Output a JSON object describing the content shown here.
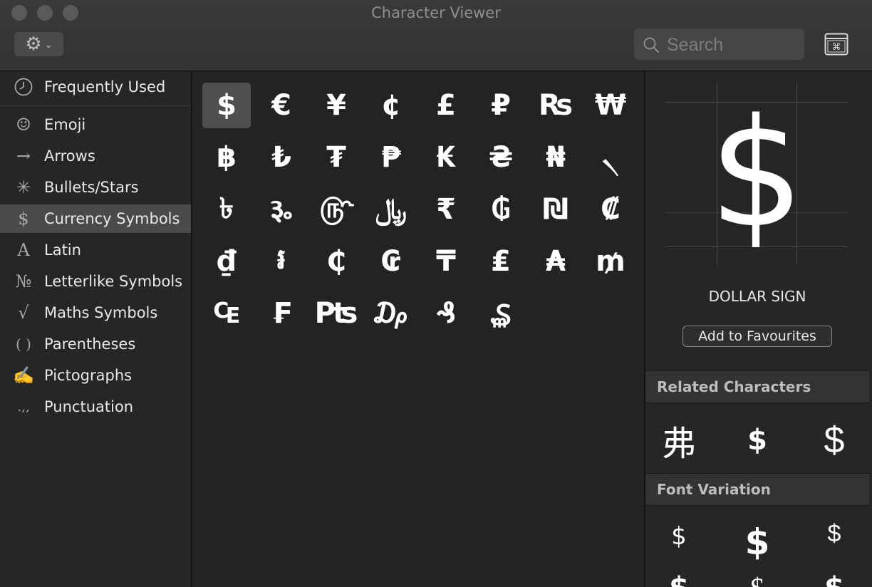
{
  "window": {
    "title": "Character Viewer"
  },
  "toolbar": {
    "search_placeholder": "Search"
  },
  "sidebar": {
    "items": [
      {
        "label": "Frequently Used",
        "icon": "clock-icon",
        "glyph": "◷"
      },
      {
        "label": "Emoji",
        "icon": "smiley-icon",
        "glyph": "☺"
      },
      {
        "label": "Arrows",
        "icon": "arrow-right-icon",
        "glyph": "→"
      },
      {
        "label": "Bullets/Stars",
        "icon": "asterisk-icon",
        "glyph": "✳"
      },
      {
        "label": "Currency Symbols",
        "icon": "dollar-icon",
        "glyph": "$"
      },
      {
        "label": "Latin",
        "icon": "letter-a-icon",
        "glyph": "A"
      },
      {
        "label": "Letterlike Symbols",
        "icon": "numero-icon",
        "glyph": "№"
      },
      {
        "label": "Maths Symbols",
        "icon": "square-root-icon",
        "glyph": "√"
      },
      {
        "label": "Parentheses",
        "icon": "parentheses-icon",
        "glyph": "( )"
      },
      {
        "label": "Pictographs",
        "icon": "writing-hand-icon",
        "glyph": "✍"
      },
      {
        "label": "Punctuation",
        "icon": "comma-icon",
        "glyph": "․,,"
      }
    ],
    "selected_index": 4
  },
  "characters": [
    "$",
    "€",
    "¥",
    "¢",
    "£",
    "₽",
    "₨",
    "₩",
    "฿",
    "₺",
    "₮",
    "₱",
    "₭",
    "₴",
    "₦",
    "৲",
    "৳",
    "૱",
    "௹",
    "﷼",
    "₹",
    "₲",
    "₪",
    "₡",
    "₫",
    "៛",
    "₵",
    "₢",
    "₸",
    "₤",
    "₳",
    "₥",
    "₠",
    "₣",
    "₧",
    "₯",
    "₰",
    "₷"
  ],
  "selected_character_index": 0,
  "detail": {
    "glyph": "$",
    "name": "DOLLAR SIGN",
    "favourite_label": "Add to Favourites",
    "related_header": "Related Characters",
    "related": [
      "弗",
      "$",
      "$"
    ],
    "variation_header": "Font Variation",
    "variations": [
      "$",
      "$",
      "$",
      "$",
      "$",
      "$"
    ]
  },
  "colors": {
    "background": "#232323",
    "sidebar": "#262626",
    "selection": "#4a4a4a",
    "text": "#e8e8e8"
  }
}
